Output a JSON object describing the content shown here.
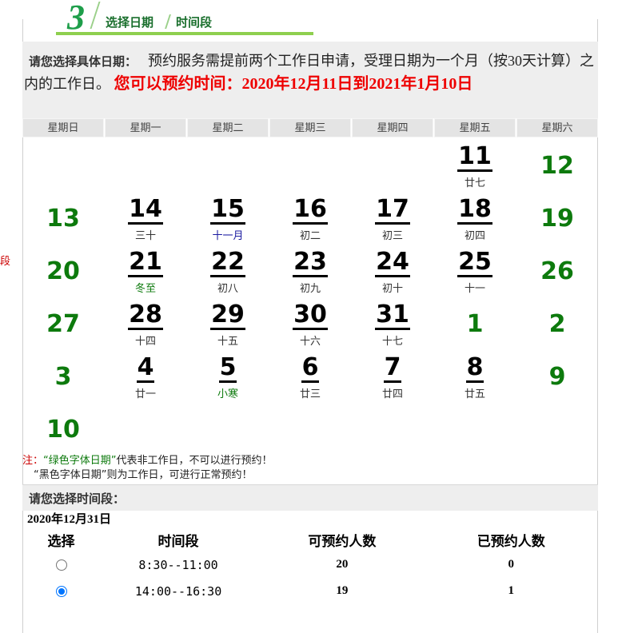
{
  "edge_fragment": "段",
  "step": {
    "number": "3",
    "label": "选择日期",
    "sub_label": "时间段"
  },
  "notice": {
    "label": "请您选择具体日期：",
    "text": "预约服务需提前两个工作日申请，受理日期为一个月（按30天计算）之内的工作日。",
    "range": "您可以预约时间：2020年12月11日到2021年1月10日"
  },
  "weekdays": [
    "星期日",
    "星期一",
    "星期二",
    "星期三",
    "星期四",
    "星期五",
    "星期六"
  ],
  "calendar": [
    {
      "day": "11",
      "lunar": "廿七",
      "type": "work"
    },
    {
      "day": "12",
      "lunar": "",
      "type": "off"
    },
    {
      "day": "13",
      "lunar": "",
      "type": "off"
    },
    {
      "day": "14",
      "lunar": "三十",
      "type": "work"
    },
    {
      "day": "15",
      "lunar": "十一月",
      "type": "work",
      "lunar_color": "blue"
    },
    {
      "day": "16",
      "lunar": "初二",
      "type": "work"
    },
    {
      "day": "17",
      "lunar": "初三",
      "type": "work"
    },
    {
      "day": "18",
      "lunar": "初四",
      "type": "work"
    },
    {
      "day": "19",
      "lunar": "",
      "type": "off"
    },
    {
      "day": "20",
      "lunar": "",
      "type": "off"
    },
    {
      "day": "21",
      "lunar": "冬至",
      "type": "work",
      "lunar_color": "green"
    },
    {
      "day": "22",
      "lunar": "初八",
      "type": "work"
    },
    {
      "day": "23",
      "lunar": "初九",
      "type": "work"
    },
    {
      "day": "24",
      "lunar": "初十",
      "type": "work"
    },
    {
      "day": "25",
      "lunar": "十一",
      "type": "work"
    },
    {
      "day": "26",
      "lunar": "",
      "type": "off"
    },
    {
      "day": "27",
      "lunar": "",
      "type": "off"
    },
    {
      "day": "28",
      "lunar": "十四",
      "type": "work"
    },
    {
      "day": "29",
      "lunar": "十五",
      "type": "work"
    },
    {
      "day": "30",
      "lunar": "十六",
      "type": "work"
    },
    {
      "day": "31",
      "lunar": "十七",
      "type": "work"
    },
    {
      "day": "1",
      "lunar": "",
      "type": "off"
    },
    {
      "day": "2",
      "lunar": "",
      "type": "off"
    },
    {
      "day": "3",
      "lunar": "",
      "type": "off"
    },
    {
      "day": "4",
      "lunar": "廿一",
      "type": "work"
    },
    {
      "day": "5",
      "lunar": "小寒",
      "type": "work",
      "lunar_color": "green"
    },
    {
      "day": "6",
      "lunar": "廿三",
      "type": "work"
    },
    {
      "day": "7",
      "lunar": "廿四",
      "type": "work"
    },
    {
      "day": "8",
      "lunar": "廿五",
      "type": "work"
    },
    {
      "day": "9",
      "lunar": "",
      "type": "off"
    },
    {
      "day": "10",
      "lunar": "",
      "type": "off"
    }
  ],
  "legend": {
    "prefix": "注：",
    "green_text": "“绿色字体日期”",
    "line1_rest": "代表非工作日，不可以进行预约！",
    "line2": "“黑色字体日期”则为工作日，可进行正常预约！"
  },
  "time_section": {
    "title": "请您选择时间段：",
    "selected_date": "2020年12月31日"
  },
  "slot_headers": [
    "选择",
    "时间段",
    "可预约人数",
    "已预约人数"
  ],
  "slots": [
    {
      "time": "8:30--11:00",
      "available": "20",
      "booked": "0",
      "selected": false
    },
    {
      "time": "14:00--16:30",
      "available": "19",
      "booked": "1",
      "selected": true
    }
  ],
  "colors": {
    "off_day": "#0d7a0d",
    "range_text": "#e00000",
    "accent": "#8ecf4e",
    "radio": "#0075ff"
  }
}
